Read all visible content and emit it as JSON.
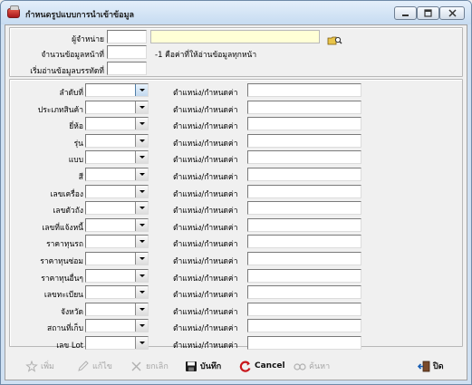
{
  "window": {
    "title": "กำหนดรูปแบบการนำเข้าข้อมูล"
  },
  "header": {
    "vendor_label": "ผู้จำหน่าย",
    "vendor_code": "",
    "vendor_name": "",
    "rows_per_page_label": "จำนวนข้อมูลหน้าที่",
    "rows_per_page_value": "",
    "rows_note": "-1 คือค่าที่ให้อ่านข้อมูลทุกหน้า",
    "start_row_label": "เริ่มอ่านข้อมูลบรรทัดที่",
    "start_row_value": ""
  },
  "mapping": {
    "position_label": "ตำแหน่ง/กำหนดค่า",
    "rows": [
      {
        "label": "ลำดับที่",
        "column": "",
        "value": ""
      },
      {
        "label": "ประเภทสินค้า",
        "column": "",
        "value": ""
      },
      {
        "label": "ยี่ห้อ",
        "column": "",
        "value": ""
      },
      {
        "label": "รุ่น",
        "column": "",
        "value": ""
      },
      {
        "label": "แบบ",
        "column": "",
        "value": ""
      },
      {
        "label": "สี",
        "column": "",
        "value": ""
      },
      {
        "label": "เลขเครื่อง",
        "column": "",
        "value": ""
      },
      {
        "label": "เลขตัวถัง",
        "column": "",
        "value": ""
      },
      {
        "label": "เลขที่แจ้งหนี้",
        "column": "",
        "value": ""
      },
      {
        "label": "ราคาทุนรถ",
        "column": "",
        "value": ""
      },
      {
        "label": "ราคาทุนซ่อม",
        "column": "",
        "value": ""
      },
      {
        "label": "ราคาทุนอื่นๆ",
        "column": "",
        "value": ""
      },
      {
        "label": "เลขทะเบียน",
        "column": "",
        "value": ""
      },
      {
        "label": "จังหวัด",
        "column": "",
        "value": ""
      },
      {
        "label": "สถานที่เก็บ",
        "column": "",
        "value": ""
      },
      {
        "label": "เลข Lot",
        "column": "",
        "value": ""
      }
    ]
  },
  "toolbar": {
    "add": "เพิ่ม",
    "edit": "แก้ไข",
    "cancel_doc": "ยกเลิก",
    "save": "บันทึก",
    "cancel": "Cancel",
    "search": "ค้นหา",
    "close": "ปิด"
  },
  "icons": [
    "app-icon",
    "vendor-search-icon",
    "add-icon",
    "edit-icon",
    "cancel-x-icon",
    "save-icon",
    "cancel-icon",
    "search-icon",
    "exit-icon"
  ],
  "colors": {
    "title_bar": "#c6dbf1",
    "vendor_name_bg": "#ffffd6",
    "cancel_icon": "#c8161b"
  }
}
